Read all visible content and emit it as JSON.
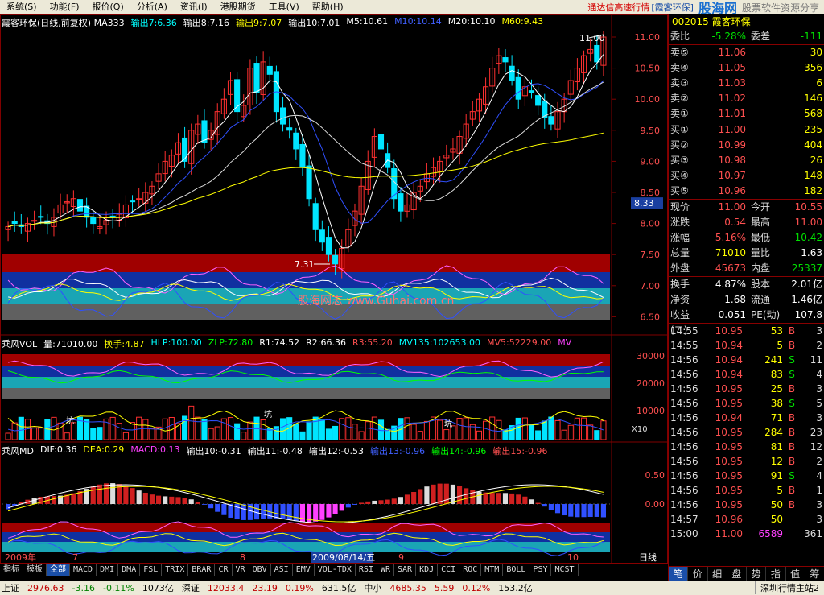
{
  "menubar": {
    "items": [
      "系统(S)",
      "功能(F)",
      "报价(Q)",
      "分析(A)",
      "资讯(I)",
      "港股期货",
      "工具(V)",
      "帮助(H)"
    ],
    "promo": "通达信高速行情",
    "promo_stock": "[霞客环保]",
    "logo": "股海网",
    "logo_sub": "股票软件资源分享"
  },
  "chart": {
    "main_title": "霞客环保(日线,前复权) MA333",
    "main_outputs": [
      {
        "text": "输出7:6.36",
        "color": "#00ffff"
      },
      {
        "text": "输出8:7.16",
        "color": "#ffffff"
      },
      {
        "text": "输出9:7.07",
        "color": "#ffff00"
      },
      {
        "text": "输出10:7.01",
        "color": "#ffffff"
      },
      {
        "text": "M5:10.61",
        "color": "#ffffff"
      },
      {
        "text": "M10:10.14",
        "color": "#4060ff"
      },
      {
        "text": "M20:10.10",
        "color": "#ffffff"
      },
      {
        "text": "M60:9.43",
        "color": "#ffff00"
      }
    ],
    "vol_title": "乘风VOL",
    "vol_outputs": [
      {
        "text": "量:71010.00",
        "color": "#ffffff"
      },
      {
        "text": "换手:4.87",
        "color": "#ffff00"
      },
      {
        "text": "HLP:100.00",
        "color": "#00ffff"
      },
      {
        "text": "ZLP:72.80",
        "color": "#00ff00"
      },
      {
        "text": "R1:74.52",
        "color": "#ffffff"
      },
      {
        "text": "R2:66.36",
        "color": "#ffffff"
      },
      {
        "text": "R3:55.20",
        "color": "#ff5050"
      },
      {
        "text": "MV135:102653.00",
        "color": "#00ffff"
      },
      {
        "text": "MV5:52229.00",
        "color": "#ff5050"
      },
      {
        "text": "MV",
        "color": "#ff40ff"
      }
    ],
    "md_title": "乘风MD",
    "md_outputs": [
      {
        "text": "DIF:0.36",
        "color": "#ffffff"
      },
      {
        "text": "DEA:0.29",
        "color": "#ffff00"
      },
      {
        "text": "MACD:0.13",
        "color": "#ff40ff"
      },
      {
        "text": "输出10:-0.31",
        "color": "#ffffff"
      },
      {
        "text": "输出11:-0.48",
        "color": "#ffffff"
      },
      {
        "text": "输出12:-0.53",
        "color": "#ffffff"
      },
      {
        "text": "输出13:-0.96",
        "color": "#4060ff"
      },
      {
        "text": "输出14:-0.96",
        "color": "#00ff00"
      },
      {
        "text": "输出15:-0.96",
        "color": "#ff5050"
      }
    ],
    "price_axis": [
      "11.00",
      "10.50",
      "10.00",
      "9.50",
      "9.00",
      "8.50",
      "8.00",
      "7.50",
      "7.00",
      "6.50"
    ],
    "price_marker": "8.33",
    "high_label": "11.00",
    "low_label": "7.31",
    "vol_axis": [
      "30000",
      "20000",
      "10000"
    ],
    "vol_unit": "X10",
    "md_axis": [
      "0.50",
      "0.00"
    ],
    "watermark": "股海网志  www.Guhai.com.cn",
    "date_axis": [
      "2009年",
      "7",
      "8",
      "2009/08/14/五",
      "9",
      "10"
    ],
    "period_label": "日线",
    "keng_label": "坑"
  },
  "right_panel": {
    "title": "002015 霞客环保",
    "weibi_label": "委比",
    "weibi_value": "-5.28%",
    "weicha_label": "委差",
    "weicha_value": "-111",
    "sells": [
      {
        "label": "卖⑤",
        "price": "11.06",
        "vol": "30"
      },
      {
        "label": "卖④",
        "price": "11.05",
        "vol": "356"
      },
      {
        "label": "卖③",
        "price": "11.03",
        "vol": "6"
      },
      {
        "label": "卖②",
        "price": "11.02",
        "vol": "146"
      },
      {
        "label": "卖①",
        "price": "11.01",
        "vol": "568"
      }
    ],
    "buys": [
      {
        "label": "买①",
        "price": "11.00",
        "vol": "235"
      },
      {
        "label": "买②",
        "price": "10.99",
        "vol": "404"
      },
      {
        "label": "买③",
        "price": "10.98",
        "vol": "26"
      },
      {
        "label": "买④",
        "price": "10.97",
        "vol": "148"
      },
      {
        "label": "买⑤",
        "price": "10.96",
        "vol": "182"
      }
    ],
    "stats": [
      {
        "k": "现价",
        "v": "11.00",
        "vc": "red",
        "k2": "今开",
        "v2": "10.55",
        "v2c": "red"
      },
      {
        "k": "涨跌",
        "v": "0.54",
        "vc": "red",
        "k2": "最高",
        "v2": "11.00",
        "v2c": "red"
      },
      {
        "k": "涨幅",
        "v": "5.16%",
        "vc": "red",
        "k2": "最低",
        "v2": "10.42",
        "v2c": "green"
      },
      {
        "k": "总量",
        "v": "71010",
        "vc": "yellow",
        "k2": "量比",
        "v2": "1.63",
        "v2c": "white"
      },
      {
        "k": "外盘",
        "v": "45673",
        "vc": "red",
        "k2": "内盘",
        "v2": "25337",
        "v2c": "green"
      }
    ],
    "stats2": [
      {
        "k": "换手",
        "v": "4.87%",
        "vc": "white",
        "k2": "股本",
        "v2": "2.01亿",
        "v2c": "white"
      },
      {
        "k": "净资",
        "v": "1.68",
        "vc": "white",
        "k2": "流通",
        "v2": "1.46亿",
        "v2c": "white"
      },
      {
        "k": "收益(二)",
        "v": "0.051",
        "vc": "white",
        "k2": "PE(动)",
        "v2": "107.8",
        "v2c": "white"
      }
    ],
    "ticks": [
      {
        "t": "14:55",
        "p": "10.95",
        "v": "53",
        "bs": "B",
        "n": "3"
      },
      {
        "t": "14:55",
        "p": "10.94",
        "v": "5",
        "bs": "B",
        "n": "2"
      },
      {
        "t": "14:56",
        "p": "10.94",
        "v": "241",
        "bs": "S",
        "n": "11"
      },
      {
        "t": "14:56",
        "p": "10.94",
        "v": "83",
        "bs": "S",
        "n": "4"
      },
      {
        "t": "14:56",
        "p": "10.95",
        "v": "25",
        "bs": "B",
        "n": "3"
      },
      {
        "t": "14:56",
        "p": "10.95",
        "v": "38",
        "bs": "S",
        "n": "5"
      },
      {
        "t": "14:56",
        "p": "10.94",
        "v": "71",
        "bs": "B",
        "n": "3"
      },
      {
        "t": "14:56",
        "p": "10.95",
        "v": "284",
        "bs": "B",
        "n": "23"
      },
      {
        "t": "14:56",
        "p": "10.95",
        "v": "81",
        "bs": "B",
        "n": "12"
      },
      {
        "t": "14:56",
        "p": "10.95",
        "v": "12",
        "bs": "B",
        "n": "2"
      },
      {
        "t": "14:56",
        "p": "10.95",
        "v": "91",
        "bs": "S",
        "n": "4"
      },
      {
        "t": "14:56",
        "p": "10.95",
        "v": "5",
        "bs": "B",
        "n": "1"
      },
      {
        "t": "14:56",
        "p": "10.95",
        "v": "50",
        "bs": "B",
        "n": "3"
      },
      {
        "t": "14:57",
        "p": "10.96",
        "v": "50",
        "bs": "",
        "n": "3"
      },
      {
        "t": "15:00",
        "p": "11.00",
        "v": "6589",
        "bs": "",
        "n": "361"
      }
    ],
    "tabs": [
      "笔",
      "价",
      "细",
      "盘",
      "势",
      "指",
      "值",
      "筹"
    ]
  },
  "indicator_tabs": [
    "指标",
    "模板",
    "全部",
    "MACD",
    "DMI",
    "DMA",
    "FSL",
    "TRIX",
    "BRAR",
    "CR",
    "VR",
    "OBV",
    "ASI",
    "EMV",
    "VOL-TDX",
    "RSI",
    "WR",
    "SAR",
    "KDJ",
    "CCI",
    "ROC",
    "MTM",
    "BOLL",
    "PSY",
    "MCST"
  ],
  "statusbar": {
    "sh_label": "上证",
    "sh_value": "2976.63",
    "sh_change": "-3.16",
    "sh_pct": "-0.11%",
    "sh_amt": "1073亿",
    "sz_label": "深证",
    "sz_value": "12033.4",
    "sz_change": "23.19",
    "sz_pct": "0.19%",
    "sz_amt": "631.5亿",
    "zx_label": "中小",
    "zx_value": "4685.35",
    "zx_change": "5.59",
    "zx_pct": "0.12%",
    "zx_amt": "153.2亿",
    "server": "深圳行情主站2"
  },
  "colors": {
    "up": "#ff3030",
    "down": "#00e5ff",
    "ma5": "#ffffff",
    "ma10": "#3050ff",
    "ma20": "#ffffff",
    "ma60": "#ffff00",
    "band_red": "#a00000",
    "band_blue": "#1030a0",
    "band_cyan": "#1aa5b5",
    "band_gray": "#606060"
  }
}
